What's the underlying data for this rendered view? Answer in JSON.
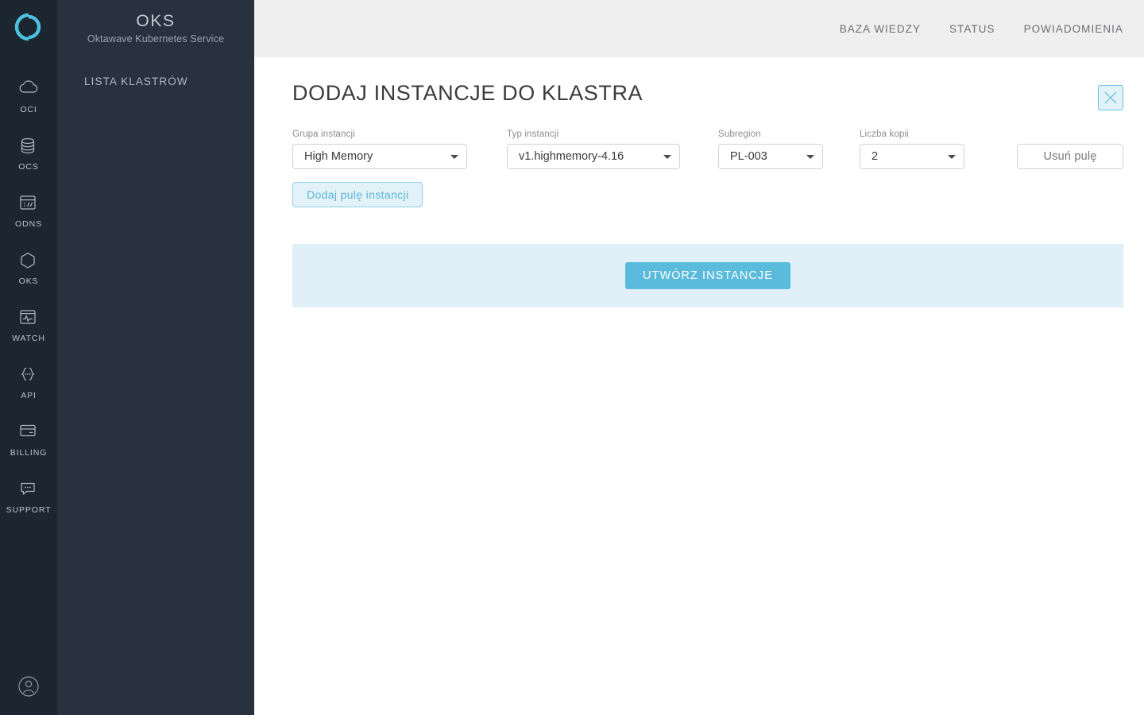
{
  "rail": {
    "logo_icon": "oktawave-ring-logo",
    "items": [
      {
        "label": "OCI",
        "icon": "cloud-icon"
      },
      {
        "label": "OCS",
        "icon": "database-icon"
      },
      {
        "label": "ODNS",
        "icon": "browser-url-icon"
      },
      {
        "label": "OKS",
        "icon": "hexagon-icon"
      },
      {
        "label": "WATCH",
        "icon": "monitor-pulse-icon"
      },
      {
        "label": "API",
        "icon": "curly-braces-icon"
      },
      {
        "label": "BILLING",
        "icon": "credit-card-icon"
      },
      {
        "label": "SUPPORT",
        "icon": "chat-bubble-icon"
      }
    ],
    "avatar_icon": "user-avatar-icon"
  },
  "panel": {
    "title": "OKS",
    "subtitle": "Oktawave Kubernetes Service",
    "menu": [
      {
        "label": "LISTA KLASTRÓW"
      }
    ]
  },
  "topnav": {
    "items": [
      {
        "label": "BAZA WIEDZY"
      },
      {
        "label": "STATUS"
      },
      {
        "label": "POWIADOMIENIA"
      }
    ]
  },
  "page": {
    "title": "DODAJ INSTANCJE DO KLASTRA",
    "close_icon": "close-x-icon"
  },
  "form": {
    "fields": {
      "group": {
        "label": "Grupa instancji",
        "value": "High Memory",
        "caret_icon": "chevron-down-icon"
      },
      "type": {
        "label": "Typ instancji",
        "value": "v1.highmemory-4.16",
        "caret_icon": "chevron-down-icon"
      },
      "subregion": {
        "label": "Subregion",
        "value": "PL-003",
        "caret_icon": "chevron-down-icon"
      },
      "copies": {
        "label": "Liczba kopii",
        "value": "2",
        "caret_icon": "chevron-down-icon"
      }
    },
    "remove_pool_label": "Usuń pulę",
    "add_pool_label": "Dodaj pulę instancji"
  },
  "actions": {
    "create_label": "UTWÓRZ INSTANCJE"
  },
  "colors": {
    "rail_bg": "#1c2631",
    "panel_bg": "#28323f",
    "topbar_bg": "#efefef",
    "accent": "#5bbbdd",
    "accent_soft": "#e3f1f8",
    "action_bar_bg": "#e1eff8",
    "logo": "#4cc0e0"
  }
}
